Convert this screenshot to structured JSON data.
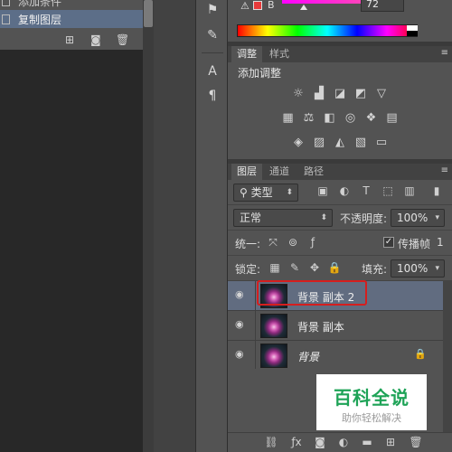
{
  "history": {
    "items": [
      {
        "label": "添加条件"
      },
      {
        "label": "复制图层"
      }
    ]
  },
  "color_panel": {
    "channel_label": "B",
    "channel_value": "72",
    "chip_color": "#e83b3b"
  },
  "adjustments": {
    "tabs": [
      "调整",
      "样式"
    ],
    "title": "添加调整",
    "row1": [
      "brightness-icon",
      "levels-icon",
      "curves-icon",
      "exposure-icon",
      "vibrance-icon"
    ],
    "row2": [
      "hue-saturation-icon",
      "color-balance-icon",
      "black-white-icon",
      "photo-filter-icon",
      "channel-mixer-icon",
      "color-lookup-icon"
    ],
    "row3": [
      "invert-icon",
      "posterize-icon",
      "threshold-icon",
      "selective-color-icon",
      "gradient-map-icon"
    ]
  },
  "layers": {
    "tabs": [
      "图层",
      "通道",
      "路径"
    ],
    "filter_kind": "类型",
    "blend_mode": "正常",
    "opacity_label": "不透明度:",
    "opacity_value": "100%",
    "unify_label": "统一:",
    "propagate_label": "传播帧",
    "propagate_value": "1",
    "lock_label": "锁定:",
    "fill_label": "填充:",
    "fill_value": "100%",
    "rows": [
      {
        "name": "背景 副本 2",
        "selected": true
      },
      {
        "name": "背景 副本",
        "selected": false
      },
      {
        "name": "背景",
        "selected": false,
        "locked": true
      }
    ]
  },
  "watermark": {
    "main": "百科全说",
    "sub": "助你轻松解决"
  }
}
